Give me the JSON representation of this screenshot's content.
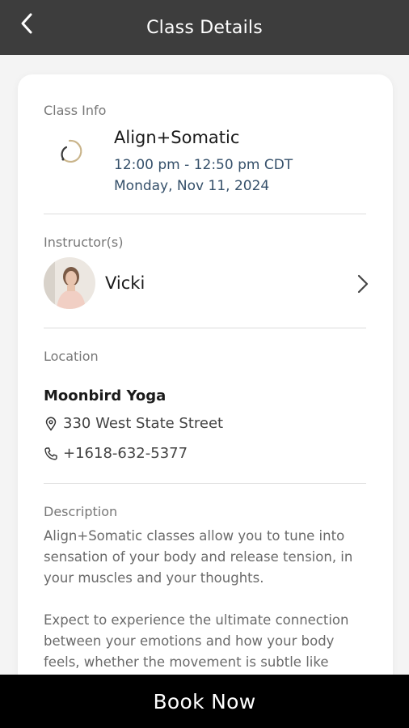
{
  "header": {
    "title": "Class Details"
  },
  "class_info": {
    "label": "Class Info",
    "name": "Align+Somatic",
    "time": "12:00 pm - 12:50 pm CDT",
    "date": "Monday, Nov 11, 2024"
  },
  "instructor": {
    "label": "Instructor(s)",
    "name": "Vicki"
  },
  "location": {
    "label": "Location",
    "name": "Moonbird Yoga",
    "address": "330 West State Street",
    "phone": "+1618-632-5377"
  },
  "description": {
    "label": "Description",
    "paragraphs": [
      "Align+Somatic classes allow you to tune into sensation of your body and release tension, in your muscles and your thoughts.",
      "Expect to experience the ultimate connection between your emotions and how your body feels, whether the movement is subtle like"
    ]
  },
  "footer": {
    "book_label": "Book Now"
  },
  "colors": {
    "topbar": "#3d3d3d",
    "accent_text": "#35506a",
    "book_button": "#000000"
  }
}
